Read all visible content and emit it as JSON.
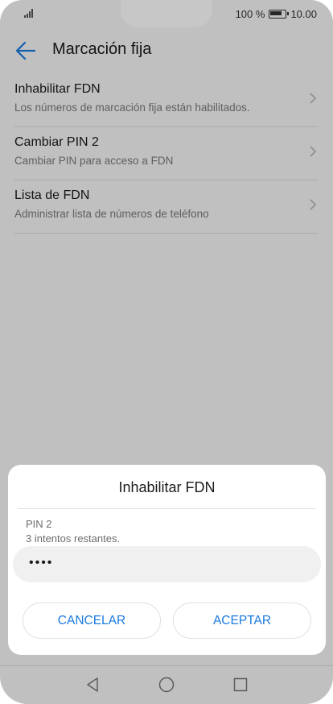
{
  "status_bar": {
    "battery_text": "100 %",
    "time": "10.00"
  },
  "app_bar": {
    "title": "Marcación fija",
    "back_icon": "arrow-left-icon",
    "accent_color": "#1a7adf"
  },
  "list": {
    "items": [
      {
        "title": "Inhabilitar FDN",
        "subtitle": "Los números de marcación fija están habilitados."
      },
      {
        "title": "Cambiar PIN 2",
        "subtitle": "Cambiar PIN para acceso a FDN"
      },
      {
        "title": "Lista de FDN",
        "subtitle": "Administrar lista de números de teléfono"
      }
    ]
  },
  "dialog": {
    "title": "Inhabilitar FDN",
    "pin_label": "PIN 2",
    "tries_text": "3 intentos restantes.",
    "pin_value": "••••",
    "cancel_label": "CANCELAR",
    "accept_label": "ACEPTAR"
  },
  "nav_bar": {
    "back": "triangle-back-icon",
    "home": "circle-home-icon",
    "recents": "square-recents-icon"
  }
}
